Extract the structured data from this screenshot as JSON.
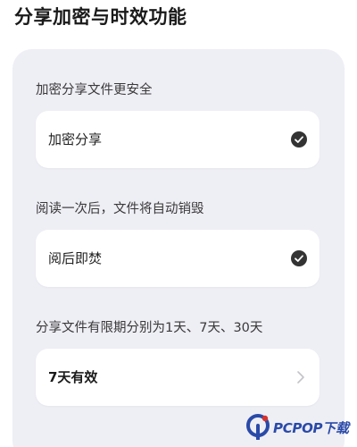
{
  "page": {
    "title": "分享加密与时效功能"
  },
  "sections": [
    {
      "description": "加密分享文件更安全",
      "option": {
        "label": "加密分享",
        "checked": true
      }
    },
    {
      "description": "阅读一次后，文件将自动销毁",
      "option": {
        "label": "阅后即焚",
        "checked": true
      }
    },
    {
      "description": "分享文件有限期分别为1天、7天、30天",
      "option": {
        "label": "7天有效",
        "has_chevron": true
      }
    }
  ],
  "watermark": {
    "text": "PCPOP下载"
  },
  "colors": {
    "panel_bg": "#eeeef5",
    "card_bg": "#ffffff",
    "check_fill": "#333333",
    "watermark_blue": "#2a4aa8",
    "watermark_red": "#d9322b"
  },
  "icons": {
    "check": "check-circle-icon",
    "chevron": "chevron-right-icon",
    "logo": "pcpop-logo-icon"
  }
}
